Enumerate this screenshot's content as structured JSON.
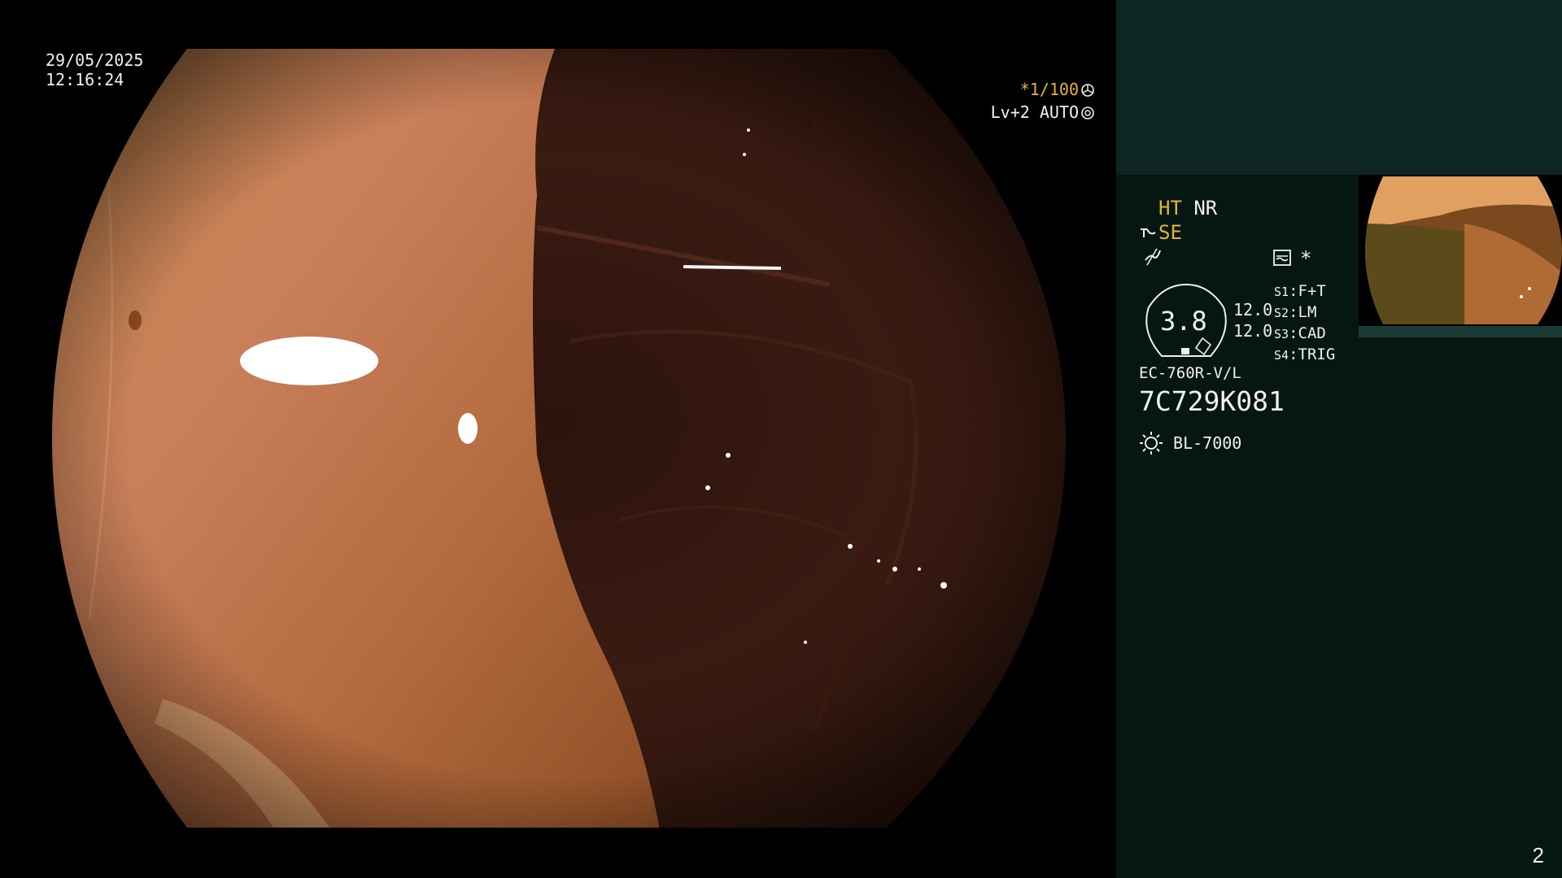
{
  "overlay": {
    "date": "29/05/2025",
    "time": "12:16:24",
    "shutter_star": "*",
    "shutter": "1/100",
    "shutter_icon": "shutter-icon",
    "level": "Lv+2",
    "mode": "AUTO",
    "mode_icon": "iris-icon"
  },
  "panel": {
    "ht": "HT",
    "nr": "NR",
    "se": "SE",
    "se_icon": "structure-enhancement-icon",
    "color_icon": "color-enhance-icon",
    "photo_icon": "image-capture-icon",
    "star": "*",
    "gauge_value": "3.8",
    "values": [
      "12.0",
      "12.0"
    ],
    "switches": [
      {
        "key": "S1",
        "label": "F+T"
      },
      {
        "key": "S2",
        "label": "LM"
      },
      {
        "key": "S3",
        "label": "CAD"
      },
      {
        "key": "S4",
        "label": "TRIG"
      }
    ],
    "scope_model": "EC-760R-V/L",
    "serial": "7C729K081",
    "light_source": "BL-7000",
    "light_icon": "light-source-icon"
  },
  "page_number": "2",
  "colors": {
    "panel_bg": "#061613",
    "panel_top": "#0d2623",
    "accent_yellow": "#e8b23a",
    "osd_text": "#f0f0f0"
  }
}
